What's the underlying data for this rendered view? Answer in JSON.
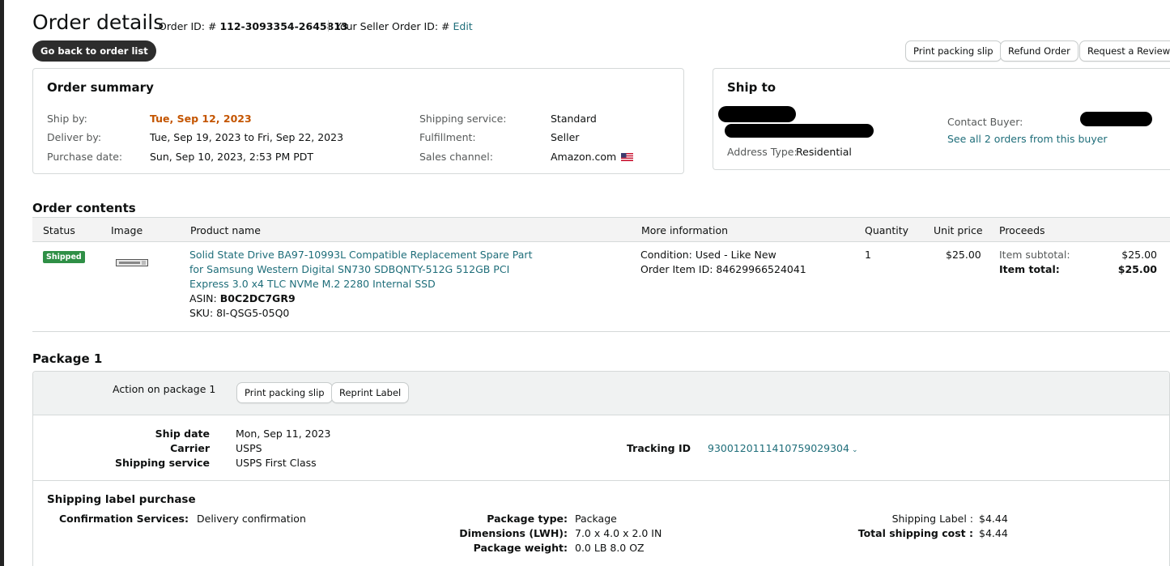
{
  "header": {
    "title": "Order details",
    "order_id_label": "Order ID: # ",
    "order_id": "112-3093354-2645813",
    "seller_order_label": "Your Seller Order ID: # ",
    "seller_order_edit": "Edit",
    "back_button": "Go back to order list",
    "print_slip_button": "Print packing slip",
    "refund_button": "Refund Order",
    "review_button": "Request a Review"
  },
  "summary": {
    "title": "Order summary",
    "ship_by_label": "Ship by:",
    "ship_by": "Tue, Sep 12, 2023",
    "deliver_by_label": "Deliver by:",
    "deliver_by": "Tue, Sep 19, 2023 to Fri, Sep 22, 2023",
    "purchase_label": "Purchase date:",
    "purchase_date": "Sun, Sep 10, 2023, 2:53 PM PDT",
    "service_label": "Shipping service:",
    "service": "Standard",
    "fulfillment_label": "Fulfillment:",
    "fulfillment": "Seller",
    "channel_label": "Sales channel:",
    "channel": "Amazon.com"
  },
  "ship_to": {
    "title": "Ship to",
    "address_type_label": "Address Type:",
    "address_type": "Residential",
    "contact_label": "Contact Buyer:",
    "see_orders": "See all 2 orders from this buyer"
  },
  "contents": {
    "title": "Order contents",
    "columns": [
      "Status",
      "Image",
      "Product name",
      "More information",
      "Quantity",
      "Unit price",
      "Proceeds"
    ],
    "status": "Shipped",
    "product_line1": "Solid State Drive BA97-10993L Compatible Replacement Spare Part",
    "product_line2": "for Samsung Western Digital SN730 SDBQNTY-512G 512GB PCI",
    "product_line3": "Express 3.0 x4 TLC NVMe M.2 2280 Internal SSD",
    "asin_label": "ASIN: ",
    "asin": "B0C2DC7GR9",
    "sku_label": "SKU: ",
    "sku": "8I-QSG5-05Q0",
    "condition": "Condition: Used - Like New",
    "order_item": "Order Item ID: 84629966524041",
    "quantity": "1",
    "unit_price": "$25.00",
    "subtotal_label": "Item subtotal:",
    "subtotal": "$25.00",
    "total_label": "Item total:",
    "total": "$25.00"
  },
  "package": {
    "title": "Package 1",
    "action_label": "Action on package 1",
    "print_slip": "Print packing slip",
    "reprint_label": "Reprint Label",
    "ship_date_label": "Ship date",
    "ship_date": "Mon, Sep 11, 2023",
    "carrier_label": "Carrier",
    "carrier": "USPS",
    "service_label": "Shipping service",
    "service": "USPS First Class",
    "tracking_label": "Tracking ID",
    "tracking": "9300120111410759029304",
    "label_purchase_title": "Shipping label purchase",
    "confirmation_label": "Confirmation Services:",
    "confirmation": "Delivery confirmation",
    "pkg_type_label": "Package type:",
    "pkg_type": "Package",
    "dimensions_label": "Dimensions (LWH):",
    "dimensions": "7.0 x 4.0 x 2.0 IN",
    "weight_label": "Package weight:",
    "weight": "0.0 LB 8.0 OZ",
    "ship_label_label": "Shipping Label :",
    "ship_label_cost": "$4.44",
    "total_cost_label": "Total shipping cost :",
    "total_cost": "$4.44"
  }
}
